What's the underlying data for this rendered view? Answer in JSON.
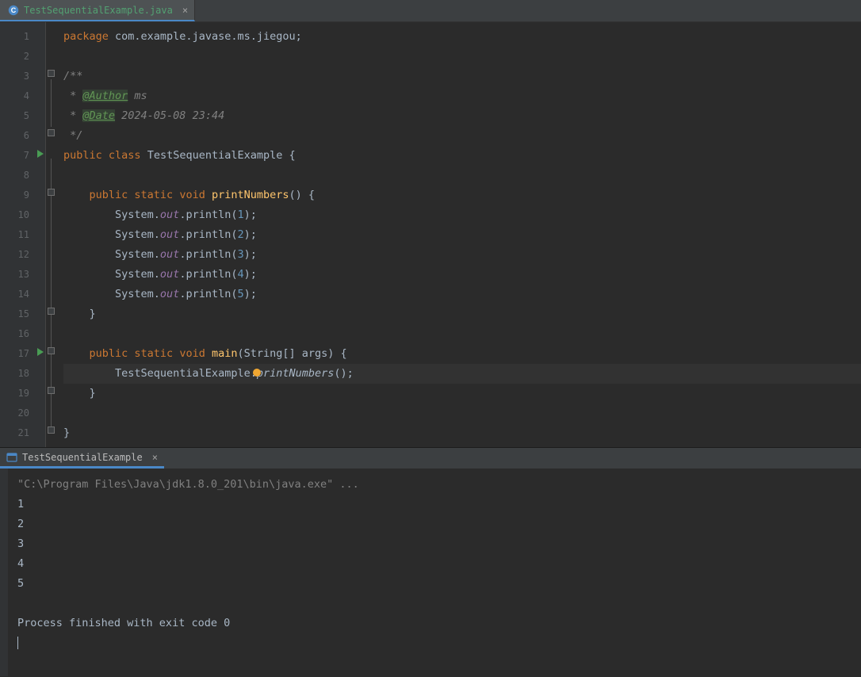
{
  "editor": {
    "tab": {
      "filename": "TestSequentialExample.java"
    },
    "lines": [
      {
        "n": "1"
      },
      {
        "n": "2"
      },
      {
        "n": "3"
      },
      {
        "n": "4"
      },
      {
        "n": "5"
      },
      {
        "n": "6"
      },
      {
        "n": "7"
      },
      {
        "n": "8"
      },
      {
        "n": "9"
      },
      {
        "n": "10"
      },
      {
        "n": "11"
      },
      {
        "n": "12"
      },
      {
        "n": "13"
      },
      {
        "n": "14"
      },
      {
        "n": "15"
      },
      {
        "n": "16"
      },
      {
        "n": "17"
      },
      {
        "n": "18"
      },
      {
        "n": "19"
      },
      {
        "n": "20"
      },
      {
        "n": "21"
      }
    ],
    "code": {
      "package_kw": "package ",
      "package_val": "com.example.javase.ms.jiegou;",
      "cm_open": "/**",
      "cm_author_prefix": " * ",
      "ann_author": "@Author",
      "cm_author_val": " ms",
      "cm_date_prefix": " * ",
      "ann_date": "@Date",
      "cm_date_val": " 2024-05-08 23:44",
      "cm_close": " */",
      "public_kw": "public ",
      "class_kw": "class ",
      "class_name": "TestSequentialExample ",
      "brace_open": "{",
      "static_kw": "static ",
      "void_kw": "void ",
      "method1": "printNumbers",
      "method1_sig": "() {",
      "sysout_pre": "        System.",
      "out_field": "out",
      "println_call": ".println(",
      "n1": "1",
      "n2": "2",
      "n3": "3",
      "n4": "4",
      "n5": "5",
      "line_end": ");",
      "close_brace_m": "    }",
      "method2": "main",
      "main_args": "(String[] args) {",
      "call_class": "        TestSequentialExample.",
      "call_method": "printNumbers",
      "call_end": "();",
      "close_brace_c": "}"
    }
  },
  "run": {
    "tab_label": "TestSequentialExample",
    "cmd": "\"C:\\Program Files\\Java\\jdk1.8.0_201\\bin\\java.exe\" ...",
    "out": [
      "1",
      "2",
      "3",
      "4",
      "5"
    ],
    "exit": "Process finished with exit code 0"
  }
}
